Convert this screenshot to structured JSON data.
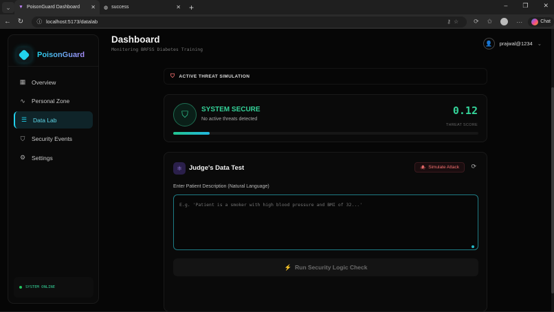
{
  "browser": {
    "tabs": [
      {
        "label": "PoisonGuard Dashboard",
        "active": true
      },
      {
        "label": "success",
        "active": false
      }
    ],
    "url": "localhost:5173/datalab",
    "chat_label": "Chat"
  },
  "sidebar": {
    "brand": "PoisonGuard",
    "items": [
      {
        "label": "Overview",
        "icon": "grid-icon"
      },
      {
        "label": "Personal Zone",
        "icon": "activity-icon"
      },
      {
        "label": "Data Lab",
        "icon": "database-icon",
        "active": true
      },
      {
        "label": "Security Events",
        "icon": "shield-alert-icon"
      },
      {
        "label": "Settings",
        "icon": "gear-icon"
      }
    ],
    "status": "SYSTEM ONLINE"
  },
  "header": {
    "title": "Dashboard",
    "subtitle": "Monitoring BRFSS Diabetes Training",
    "user": "prajwal@1234"
  },
  "banner": {
    "label": "ACTIVE THREAT SIMULATION"
  },
  "status_card": {
    "title": "SYSTEM SECURE",
    "subtitle": "No active threats detected",
    "score": "0.12",
    "score_label": "THREAT SCORE",
    "progress_percent": 12
  },
  "test_card": {
    "title": "Judge's Data Test",
    "simulate_label": "Simulate Attack",
    "input_label": "Enter Patient Description (Natural Language)",
    "input_placeholder": "E.g. 'Patient is a smoker with high blood pressure and BMI of 32...'",
    "input_value": "",
    "run_label": "Run Security Logic Check"
  },
  "colors": {
    "accent": "#22d3ee",
    "success": "#34d399",
    "danger": "#f87171"
  }
}
